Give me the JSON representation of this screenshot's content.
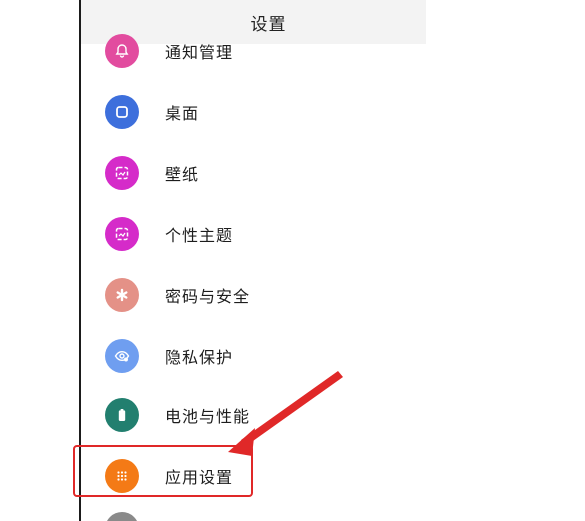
{
  "header": {
    "title": "设置"
  },
  "items": [
    {
      "label": "通知管理",
      "icon": "bell-icon",
      "color": "#e24c9f"
    },
    {
      "label": "桌面",
      "icon": "square-icon",
      "color": "#3d6fdc"
    },
    {
      "label": "壁纸",
      "icon": "wallpaper-icon",
      "color": "#d52bc9"
    },
    {
      "label": "个性主题",
      "icon": "theme-icon",
      "color": "#d52bc9"
    },
    {
      "label": "密码与安全",
      "icon": "asterisk-icon",
      "color": "#e49187"
    },
    {
      "label": "隐私保护",
      "icon": "eye-icon",
      "color": "#6f9ef0"
    },
    {
      "label": "电池与性能",
      "icon": "battery-icon",
      "color": "#227f6f"
    },
    {
      "label": "应用设置",
      "icon": "grid-icon",
      "color": "#f47a16"
    }
  ],
  "annotation": {
    "highlight_color": "#e02828"
  }
}
